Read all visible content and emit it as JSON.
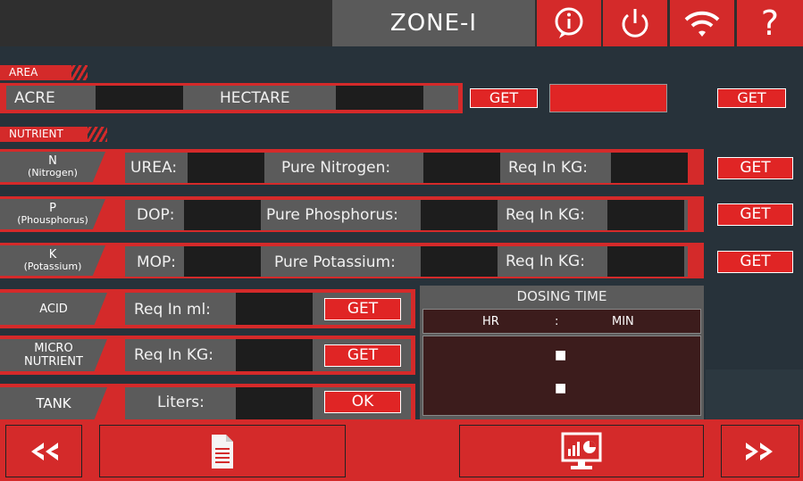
{
  "header": {
    "title": "ZONE-I"
  },
  "area": {
    "section_label": "AREA",
    "acre_label": "ACRE",
    "hectare_label": "HECTARE",
    "get_label": "GET",
    "get_label_right": "GET"
  },
  "nutrient": {
    "section_label": "NUTRIENT",
    "rows": [
      {
        "name": "N",
        "sub": "(Nitrogen)",
        "fert": "UREA:",
        "pure": "Pure Nitrogen:",
        "req": "Req In KG:",
        "get": "GET"
      },
      {
        "name": "P",
        "sub": "(Phousphorus)",
        "fert": "DOP:",
        "pure": "Pure Phosphorus:",
        "req": "Req In KG:",
        "get": "GET"
      },
      {
        "name": "K",
        "sub": "(Potassium)",
        "fert": "MOP:",
        "pure": "Pure Potassium:",
        "req": "Req In KG:",
        "get": "GET"
      }
    ]
  },
  "acid": {
    "label": "ACID",
    "field": "Req In ml:",
    "button": "GET"
  },
  "micro": {
    "label1": "MICRO",
    "label2": "NUTRIENT",
    "field": "Req In KG:",
    "button": "GET"
  },
  "tank": {
    "label": "TANK",
    "field": "Liters:",
    "button": "OK"
  },
  "dosing": {
    "title": "DOSING TIME",
    "hr": "HR",
    "sep": ":",
    "min": "MIN",
    "bullet": "■"
  },
  "colors": {
    "accent": "#d42a2a",
    "panel": "#5b5b5b",
    "background": "#27323a"
  }
}
